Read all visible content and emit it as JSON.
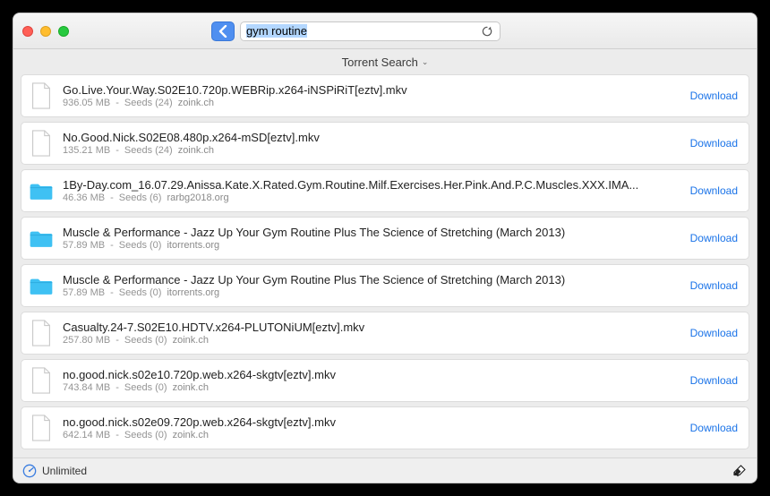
{
  "search": {
    "value": "gym routine",
    "placeholder": ""
  },
  "section_title": "Torrent Search",
  "download_label": "Download",
  "footer": {
    "speed_label": "Unlimited"
  },
  "results": [
    {
      "icon": "file",
      "title": "Go.Live.Your.Way.S02E10.720p.WEBRip.x264-iNSPiRiT[eztv].mkv",
      "size": "936.05 MB",
      "seeds": "Seeds (24)",
      "source": "zoink.ch"
    },
    {
      "icon": "file",
      "title": "No.Good.Nick.S02E08.480p.x264-mSD[eztv].mkv",
      "size": "135.21 MB",
      "seeds": "Seeds (24)",
      "source": "zoink.ch"
    },
    {
      "icon": "folder",
      "title": "1By-Day.com_16.07.29.Anissa.Kate.X.Rated.Gym.Routine.Milf.Exercises.Her.Pink.And.P.C.Muscles.XXX.IMA...",
      "size": "46.36 MB",
      "seeds": "Seeds (6)",
      "source": "rarbg2018.org"
    },
    {
      "icon": "folder",
      "title": "Muscle & Performance - Jazz Up Your Gym Routine Plus The Science of Stretching (March 2013)",
      "size": "57.89 MB",
      "seeds": "Seeds (0)",
      "source": "itorrents.org"
    },
    {
      "icon": "folder",
      "title": "Muscle & Performance - Jazz Up Your Gym Routine Plus The Science of Stretching (March 2013)",
      "size": "57.89 MB",
      "seeds": "Seeds (0)",
      "source": "itorrents.org"
    },
    {
      "icon": "file",
      "title": "Casualty.24-7.S02E10.HDTV.x264-PLUTONiUM[eztv].mkv",
      "size": "257.80 MB",
      "seeds": "Seeds (0)",
      "source": "zoink.ch"
    },
    {
      "icon": "file",
      "title": "no.good.nick.s02e10.720p.web.x264-skgtv[eztv].mkv",
      "size": "743.84 MB",
      "seeds": "Seeds (0)",
      "source": "zoink.ch"
    },
    {
      "icon": "file",
      "title": "no.good.nick.s02e09.720p.web.x264-skgtv[eztv].mkv",
      "size": "642.14 MB",
      "seeds": "Seeds (0)",
      "source": "zoink.ch"
    }
  ]
}
